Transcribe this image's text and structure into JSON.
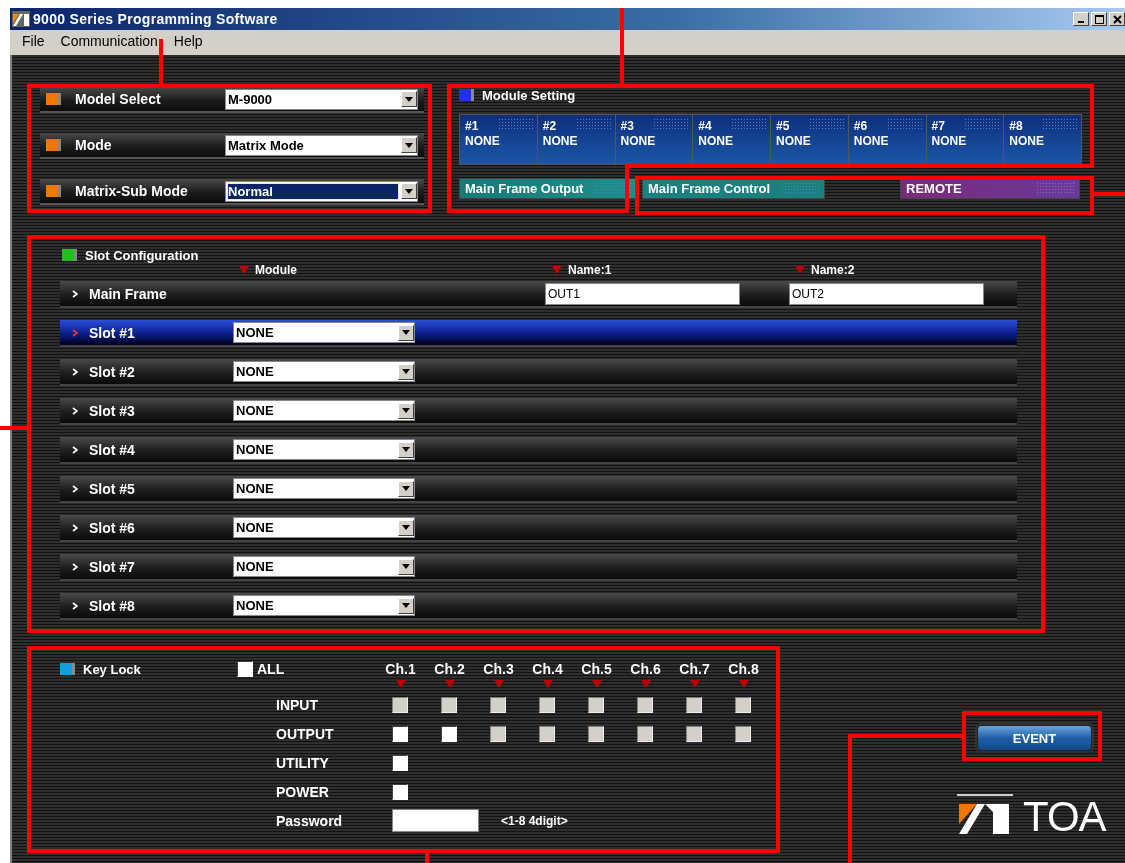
{
  "window": {
    "title": "9000 Series Programming Software"
  },
  "menu": [
    "File",
    "Communication",
    "Help"
  ],
  "system_settings": [
    {
      "label": "Model Select",
      "value": "M-9000",
      "selected": false
    },
    {
      "label": "Mode",
      "value": "Matrix Mode",
      "selected": false
    },
    {
      "label": "Matrix-Sub Mode",
      "value": "Normal",
      "selected": true
    }
  ],
  "module_setting": {
    "title": "Module Setting",
    "modules": [
      {
        "number": "#1",
        "name": "NONE"
      },
      {
        "number": "#2",
        "name": "NONE"
      },
      {
        "number": "#3",
        "name": "NONE"
      },
      {
        "number": "#4",
        "name": "NONE"
      },
      {
        "number": "#5",
        "name": "NONE"
      },
      {
        "number": "#6",
        "name": "NONE"
      },
      {
        "number": "#7",
        "name": "NONE"
      },
      {
        "number": "#8",
        "name": "NONE"
      }
    ],
    "frames": [
      {
        "label": "Main Frame Output",
        "kind": "output"
      },
      {
        "label": "Main Frame Control",
        "kind": "control"
      },
      {
        "label": "REMOTE",
        "kind": "remote"
      }
    ]
  },
  "slot_configuration": {
    "title": "Slot Configuration",
    "columns": [
      "Module",
      "Name:1",
      "Name:2"
    ],
    "main_frame": {
      "label": "Main Frame",
      "name_1": "OUT1",
      "name_2": "OUT2"
    },
    "slots": [
      {
        "label": "Slot #1",
        "module": "NONE",
        "selected": true
      },
      {
        "label": "Slot #2",
        "module": "NONE",
        "selected": false
      },
      {
        "label": "Slot #3",
        "module": "NONE",
        "selected": false
      },
      {
        "label": "Slot #4",
        "module": "NONE",
        "selected": false
      },
      {
        "label": "Slot #5",
        "module": "NONE",
        "selected": false
      },
      {
        "label": "Slot #6",
        "module": "NONE",
        "selected": false
      },
      {
        "label": "Slot #7",
        "module": "NONE",
        "selected": false
      },
      {
        "label": "Slot #8",
        "module": "NONE",
        "selected": false
      }
    ]
  },
  "key_lock": {
    "title": "Key Lock",
    "all": {
      "label": "ALL",
      "disabled": false
    },
    "channels": [
      "Ch.1",
      "Ch.2",
      "Ch.3",
      "Ch.4",
      "Ch.5",
      "Ch.6",
      "Ch.7",
      "Ch.8"
    ],
    "rows": [
      {
        "label": "INPUT",
        "boxes": [
          {
            "disabled": true
          },
          {
            "disabled": true
          },
          {
            "disabled": true
          },
          {
            "disabled": true
          },
          {
            "disabled": true
          },
          {
            "disabled": true
          },
          {
            "disabled": true
          },
          {
            "disabled": true
          }
        ]
      },
      {
        "label": "OUTPUT",
        "boxes": [
          {
            "disabled": false
          },
          {
            "disabled": false
          },
          {
            "disabled": true
          },
          {
            "disabled": true
          },
          {
            "disabled": true
          },
          {
            "disabled": true
          },
          {
            "disabled": true
          },
          {
            "disabled": true
          }
        ]
      },
      {
        "label": "UTILITY",
        "boxes": [
          {
            "disabled": false
          }
        ]
      },
      {
        "label": "POWER",
        "boxes": [
          {
            "disabled": false
          }
        ]
      }
    ],
    "password": {
      "label": "Password",
      "hint": "<1-8 4digit>"
    }
  },
  "event_button": "EVENT",
  "logo": "TOA"
}
